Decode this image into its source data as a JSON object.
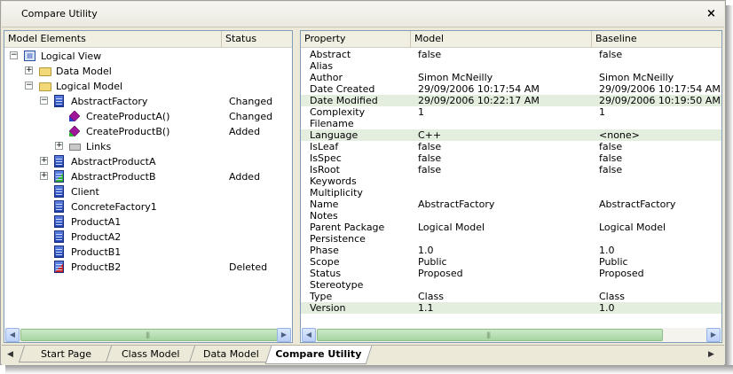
{
  "window": {
    "title": "Compare Utility",
    "close_glyph": "×"
  },
  "tree": {
    "headers": {
      "elements": "Model Elements",
      "status": "Status"
    },
    "rows": [
      {
        "label": "Logical View",
        "status": "",
        "indent": 0,
        "expander": "−",
        "icon": "package-view-icon"
      },
      {
        "label": "Data Model",
        "status": "",
        "indent": 1,
        "expander": "+",
        "icon": "folder-icon"
      },
      {
        "label": "Logical Model",
        "status": "",
        "indent": 1,
        "expander": "−",
        "icon": "folder-icon"
      },
      {
        "label": "AbstractFactory",
        "status": "Changed",
        "indent": 2,
        "expander": "−",
        "icon": "class-icon"
      },
      {
        "label": "CreateProductA()",
        "status": "Changed",
        "indent": 3,
        "expander": "",
        "icon": "operation-changed-icon"
      },
      {
        "label": "CreateProductB()",
        "status": "Added",
        "indent": 3,
        "expander": "",
        "icon": "operation-added-icon"
      },
      {
        "label": "Links",
        "status": "",
        "indent": 3,
        "expander": "+",
        "icon": "links-icon"
      },
      {
        "label": "AbstractProductA",
        "status": "",
        "indent": 2,
        "expander": "+",
        "icon": "class-icon"
      },
      {
        "label": "AbstractProductB",
        "status": "Added",
        "indent": 2,
        "expander": "+",
        "icon": "class-added-icon"
      },
      {
        "label": "Client",
        "status": "",
        "indent": 2,
        "expander": "",
        "icon": "class-icon"
      },
      {
        "label": "ConcreteFactory1",
        "status": "",
        "indent": 2,
        "expander": "",
        "icon": "class-icon"
      },
      {
        "label": "ProductA1",
        "status": "",
        "indent": 2,
        "expander": "",
        "icon": "class-icon"
      },
      {
        "label": "ProductA2",
        "status": "",
        "indent": 2,
        "expander": "",
        "icon": "class-icon"
      },
      {
        "label": "ProductB1",
        "status": "",
        "indent": 2,
        "expander": "",
        "icon": "class-icon"
      },
      {
        "label": "ProductB2",
        "status": "Deleted",
        "indent": 2,
        "expander": "",
        "icon": "class-deleted-icon"
      }
    ]
  },
  "props": {
    "headers": {
      "property": "Property",
      "model": "Model",
      "baseline": "Baseline"
    },
    "rows": [
      {
        "property": "Abstract",
        "model": "false",
        "baseline": "false",
        "diff": false
      },
      {
        "property": "Alias",
        "model": "",
        "baseline": "",
        "diff": false
      },
      {
        "property": "Author",
        "model": "Simon McNeilly",
        "baseline": "Simon McNeilly",
        "diff": false
      },
      {
        "property": "Date Created",
        "model": "29/09/2006 10:17:54 AM",
        "baseline": "29/09/2006 10:17:54 AM",
        "diff": false
      },
      {
        "property": "Date Modified",
        "model": "29/09/2006 10:22:17 AM",
        "baseline": "29/09/2006 10:19:50 AM",
        "diff": true
      },
      {
        "property": "Complexity",
        "model": "1",
        "baseline": "1",
        "diff": false
      },
      {
        "property": "Filename",
        "model": "",
        "baseline": "",
        "diff": false
      },
      {
        "property": "Language",
        "model": "C++",
        "baseline": "<none>",
        "diff": true
      },
      {
        "property": "IsLeaf",
        "model": "false",
        "baseline": "false",
        "diff": false
      },
      {
        "property": "IsSpec",
        "model": "false",
        "baseline": "false",
        "diff": false
      },
      {
        "property": "IsRoot",
        "model": "false",
        "baseline": "false",
        "diff": false
      },
      {
        "property": "Keywords",
        "model": "",
        "baseline": "",
        "diff": false
      },
      {
        "property": "Multiplicity",
        "model": "",
        "baseline": "",
        "diff": false
      },
      {
        "property": "Name",
        "model": "AbstractFactory",
        "baseline": "AbstractFactory",
        "diff": false
      },
      {
        "property": "Notes",
        "model": "",
        "baseline": "",
        "diff": false
      },
      {
        "property": "Parent Package",
        "model": "Logical Model",
        "baseline": "Logical Model",
        "diff": false
      },
      {
        "property": "Persistence",
        "model": "",
        "baseline": "",
        "diff": false
      },
      {
        "property": "Phase",
        "model": "1.0",
        "baseline": "1.0",
        "diff": false
      },
      {
        "property": "Scope",
        "model": "Public",
        "baseline": "Public",
        "diff": false
      },
      {
        "property": "Status",
        "model": "Proposed",
        "baseline": "Proposed",
        "diff": false
      },
      {
        "property": "Stereotype",
        "model": "",
        "baseline": "",
        "diff": false
      },
      {
        "property": "Type",
        "model": "Class",
        "baseline": "Class",
        "diff": false
      },
      {
        "property": "Version",
        "model": "1.1",
        "baseline": "1.0",
        "diff": true
      }
    ]
  },
  "tabs": [
    {
      "label": "Start Page",
      "active": false
    },
    {
      "label": "Class Model",
      "active": false
    },
    {
      "label": "Data Model",
      "active": false
    },
    {
      "label": "Compare Utility",
      "active": true
    }
  ],
  "colors": {
    "diff_row": "#e3eedf",
    "scroll_thumb": "#a8d5a2",
    "pane_border": "#7f9db9"
  }
}
